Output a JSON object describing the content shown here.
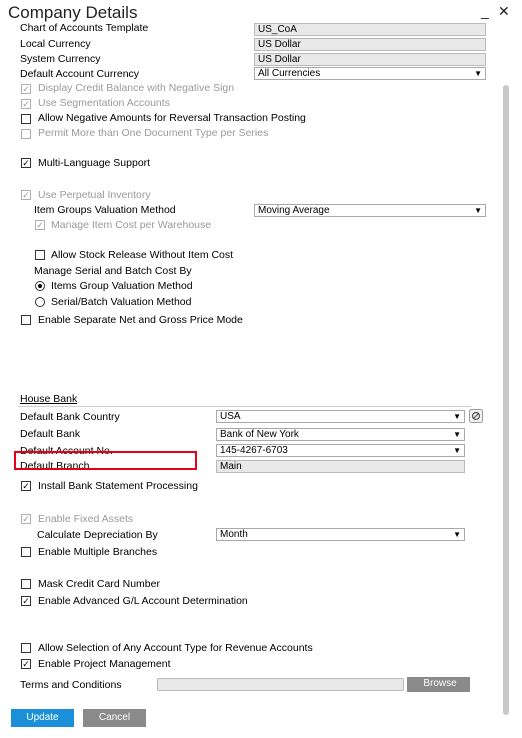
{
  "window": {
    "title": "Company Details",
    "minimize_label": "_",
    "close_label": "✕"
  },
  "accounting": {
    "coa_template_label": "Chart of Accounts Template",
    "coa_template_value": "US_CoA",
    "local_currency_label": "Local Currency",
    "local_currency_value": "US Dollar",
    "system_currency_label": "System Currency",
    "system_currency_value": "US Dollar",
    "default_account_currency_label": "Default Account Currency",
    "default_account_currency_value": "All Currencies",
    "display_credit_balance_label": "Display Credit Balance with Negative Sign",
    "use_segmentation_label": "Use Segmentation Accounts",
    "allow_negative_amounts_label": "Allow Negative Amounts for Reversal Transaction Posting",
    "permit_doc_types_label": "Permit More than One Document Type per Series",
    "multi_language_label": "Multi-Language Support"
  },
  "inventory": {
    "perpetual_label": "Use Perpetual Inventory",
    "valuation_method_label": "Item Groups Valuation Method",
    "valuation_method_value": "Moving Average",
    "manage_cost_per_wh_label": "Manage Item Cost per Warehouse",
    "allow_stock_release_label": "Allow Stock Release Without Item Cost",
    "serial_batch_cost_label": "Manage Serial and Batch Cost By",
    "radio_items_group_label": "Items Group Valuation Method",
    "radio_serial_batch_label": "Serial/Batch Valuation Method",
    "separate_net_gross_label": "Enable Separate Net and Gross Price Mode"
  },
  "house_bank": {
    "section_title": "House Bank",
    "country_label": "Default Bank Country",
    "country_value": "USA",
    "bank_label": "Default Bank",
    "bank_value": "Bank of New York",
    "account_label": "Default Account No.",
    "account_value": "145-4267-6703",
    "branch_label": "Default Branch",
    "branch_value": "Main",
    "install_statement_label": "Install Bank Statement Processing"
  },
  "assets": {
    "fixed_assets_label": "Enable Fixed Assets",
    "depreciation_label": "Calculate Depreciation By",
    "depreciation_value": "Month",
    "multiple_branches_label": "Enable Multiple Branches",
    "mask_cc_label": "Mask Credit Card Number",
    "advanced_gl_label": "Enable Advanced G/L Account Determination",
    "revenue_accounts_label": "Allow Selection of Any Account Type for Revenue Accounts",
    "project_mgmt_label": "Enable Project Management",
    "terms_label": "Terms and Conditions",
    "terms_value": "",
    "browse_label": "Browse"
  },
  "footer": {
    "update_label": "Update",
    "cancel_label": "Cancel"
  },
  "colors": {
    "accent": "#1b8fd8",
    "highlight": "#e3001b",
    "disabled": "#9a9a9a"
  }
}
